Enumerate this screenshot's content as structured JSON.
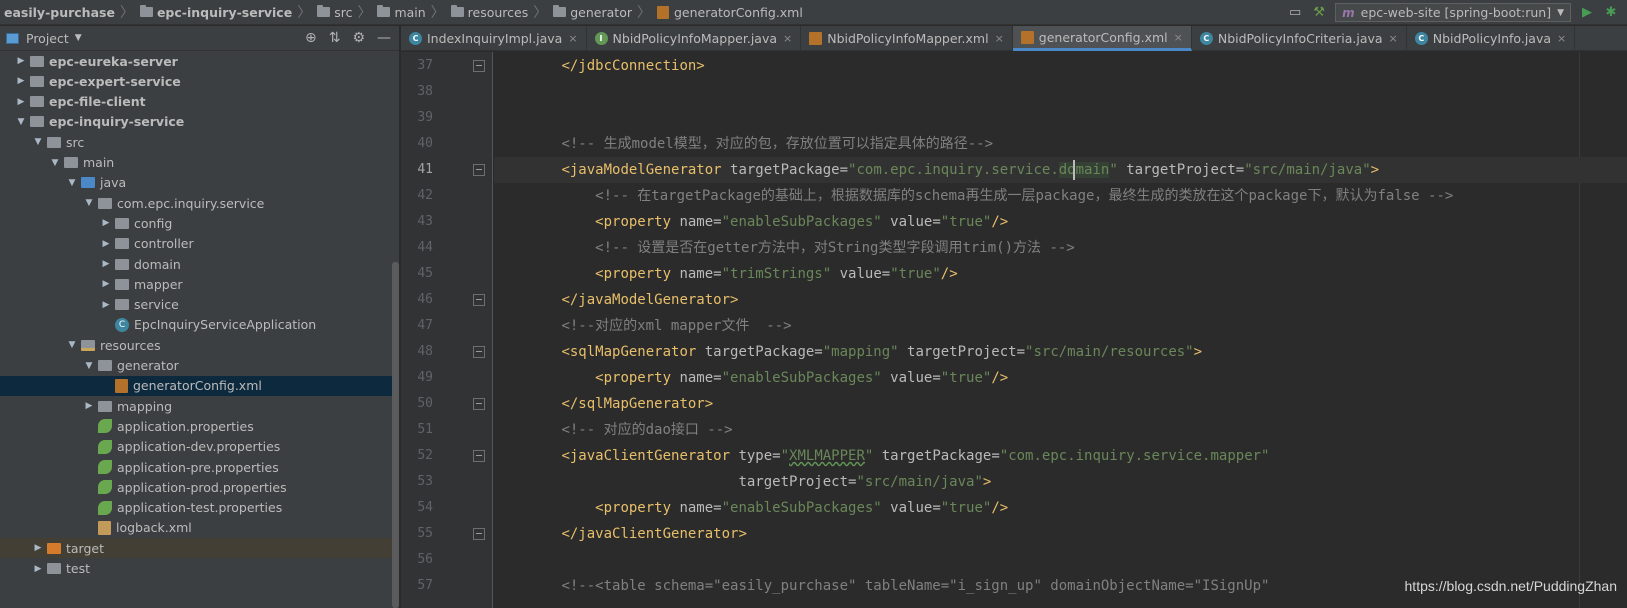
{
  "breadcrumbs": [
    "easily-purchase",
    "epc-inquiry-service",
    "src",
    "main",
    "resources",
    "generator",
    "generatorConfig.xml"
  ],
  "run_config": {
    "label": "epc-web-site [spring-boot:run]"
  },
  "project_panel": {
    "title": "Project"
  },
  "tree": [
    {
      "label": "epc-eureka-server",
      "depth": 1,
      "arrow": "right",
      "icon": "module-folder",
      "bold": true
    },
    {
      "label": "epc-expert-service",
      "depth": 1,
      "arrow": "right",
      "icon": "module-folder",
      "bold": true
    },
    {
      "label": "epc-file-client",
      "depth": 1,
      "arrow": "right",
      "icon": "module-folder",
      "bold": true
    },
    {
      "label": "epc-inquiry-service",
      "depth": 1,
      "arrow": "down",
      "icon": "module-folder",
      "bold": true
    },
    {
      "label": "src",
      "depth": 2,
      "arrow": "down",
      "icon": "folder"
    },
    {
      "label": "main",
      "depth": 3,
      "arrow": "down",
      "icon": "folder"
    },
    {
      "label": "java",
      "depth": 4,
      "arrow": "down",
      "icon": "source-folder"
    },
    {
      "label": "com.epc.inquiry.service",
      "depth": 5,
      "arrow": "down",
      "icon": "package"
    },
    {
      "label": "config",
      "depth": 6,
      "arrow": "right",
      "icon": "package"
    },
    {
      "label": "controller",
      "depth": 6,
      "arrow": "right",
      "icon": "package"
    },
    {
      "label": "domain",
      "depth": 6,
      "arrow": "right",
      "icon": "package"
    },
    {
      "label": "mapper",
      "depth": 6,
      "arrow": "right",
      "icon": "package"
    },
    {
      "label": "service",
      "depth": 6,
      "arrow": "right",
      "icon": "package"
    },
    {
      "label": "EpcInquiryServiceApplication",
      "depth": 6,
      "arrow": "none",
      "icon": "spring-class"
    },
    {
      "label": "resources",
      "depth": 4,
      "arrow": "down",
      "icon": "resources-folder"
    },
    {
      "label": "generator",
      "depth": 5,
      "arrow": "down",
      "icon": "folder"
    },
    {
      "label": "generatorConfig.xml",
      "depth": 6,
      "arrow": "none",
      "icon": "xml-file",
      "selected": true
    },
    {
      "label": "mapping",
      "depth": 5,
      "arrow": "right",
      "icon": "folder"
    },
    {
      "label": "application.properties",
      "depth": 5,
      "arrow": "none",
      "icon": "spring-properties"
    },
    {
      "label": "application-dev.properties",
      "depth": 5,
      "arrow": "none",
      "icon": "spring-properties"
    },
    {
      "label": "application-pre.properties",
      "depth": 5,
      "arrow": "none",
      "icon": "spring-properties"
    },
    {
      "label": "application-prod.properties",
      "depth": 5,
      "arrow": "none",
      "icon": "spring-properties"
    },
    {
      "label": "application-test.properties",
      "depth": 5,
      "arrow": "none",
      "icon": "spring-properties"
    },
    {
      "label": "logback.xml",
      "depth": 5,
      "arrow": "none",
      "icon": "logback-file"
    },
    {
      "label": "target",
      "depth": 2,
      "arrow": "right",
      "icon": "excluded-folder",
      "excluded": true
    },
    {
      "label": "test",
      "depth": 2,
      "arrow": "right",
      "icon": "folder"
    }
  ],
  "tabs": [
    {
      "label": "IndexInquiryImpl.java",
      "icon": "class"
    },
    {
      "label": "NbidPolicyInfoMapper.java",
      "icon": "interface"
    },
    {
      "label": "NbidPolicyInfoMapper.xml",
      "icon": "xml"
    },
    {
      "label": "generatorConfig.xml",
      "icon": "xml",
      "active": true
    },
    {
      "label": "NbidPolicyInfoCriteria.java",
      "icon": "class"
    },
    {
      "label": "NbidPolicyInfo.java",
      "icon": "class"
    }
  ],
  "editor": {
    "current_line": 41,
    "lines": [
      {
        "n": 37,
        "fold": true,
        "tokens": [
          [
            "p",
            "        "
          ],
          [
            "tag",
            "</jdbcConnection>"
          ]
        ]
      },
      {
        "n": 38,
        "tokens": []
      },
      {
        "n": 39,
        "tokens": []
      },
      {
        "n": 40,
        "tokens": [
          [
            "p",
            "        "
          ],
          [
            "cmt",
            "<!-- 生成model模型，对应的包，存放位置可以指定具体的路径-->"
          ]
        ]
      },
      {
        "n": 41,
        "fold": true,
        "tokens": [
          [
            "p",
            "        "
          ],
          [
            "tag",
            "<javaModelGenerator"
          ],
          [
            "attr",
            " targetPackage="
          ],
          [
            "val",
            "\"com.epc.inquiry.service."
          ],
          [
            "valhl",
            "domain"
          ],
          [
            "val",
            "\""
          ],
          [
            "attr",
            " targetProject="
          ],
          [
            "val",
            "\"src/main/java\""
          ],
          [
            "tag",
            ">"
          ]
        ]
      },
      {
        "n": 42,
        "tokens": [
          [
            "p",
            "            "
          ],
          [
            "cmt",
            "<!-- 在targetPackage的基础上，根据数据库的schema再生成一层package，最终生成的类放在这个package下，默认为false -->"
          ]
        ]
      },
      {
        "n": 43,
        "tokens": [
          [
            "p",
            "            "
          ],
          [
            "tag",
            "<property"
          ],
          [
            "attr",
            " name="
          ],
          [
            "val",
            "\"enableSubPackages\""
          ],
          [
            "attr",
            " value="
          ],
          [
            "val",
            "\"true\""
          ],
          [
            "tag",
            "/>"
          ]
        ]
      },
      {
        "n": 44,
        "tokens": [
          [
            "p",
            "            "
          ],
          [
            "cmt",
            "<!-- 设置是否在getter方法中，对String类型字段调用trim()方法 -->"
          ]
        ]
      },
      {
        "n": 45,
        "tokens": [
          [
            "p",
            "            "
          ],
          [
            "tag",
            "<property"
          ],
          [
            "attr",
            " name="
          ],
          [
            "val",
            "\"trimStrings\""
          ],
          [
            "attr",
            " value="
          ],
          [
            "val",
            "\"true\""
          ],
          [
            "tag",
            "/>"
          ]
        ]
      },
      {
        "n": 46,
        "fold": true,
        "tokens": [
          [
            "p",
            "        "
          ],
          [
            "tag",
            "</javaModelGenerator>"
          ]
        ]
      },
      {
        "n": 47,
        "tokens": [
          [
            "p",
            "        "
          ],
          [
            "cmt",
            "<!--对应的xml mapper文件  -->"
          ]
        ]
      },
      {
        "n": 48,
        "fold": true,
        "tokens": [
          [
            "p",
            "        "
          ],
          [
            "tag",
            "<sqlMapGenerator"
          ],
          [
            "attr",
            " targetPackage="
          ],
          [
            "val",
            "\"mapping\""
          ],
          [
            "attr",
            " targetProject="
          ],
          [
            "val",
            "\"src/main/resources\""
          ],
          [
            "tag",
            ">"
          ]
        ]
      },
      {
        "n": 49,
        "tokens": [
          [
            "p",
            "            "
          ],
          [
            "tag",
            "<property"
          ],
          [
            "attr",
            " name="
          ],
          [
            "val",
            "\"enableSubPackages\""
          ],
          [
            "attr",
            " value="
          ],
          [
            "val",
            "\"true\""
          ],
          [
            "tag",
            "/>"
          ]
        ]
      },
      {
        "n": 50,
        "fold": true,
        "tokens": [
          [
            "p",
            "        "
          ],
          [
            "tag",
            "</sqlMapGenerator>"
          ]
        ]
      },
      {
        "n": 51,
        "tokens": [
          [
            "p",
            "        "
          ],
          [
            "cmt",
            "<!-- 对应的dao接口 -->"
          ]
        ]
      },
      {
        "n": 52,
        "fold": true,
        "tokens": [
          [
            "p",
            "        "
          ],
          [
            "tag",
            "<javaClientGenerator"
          ],
          [
            "attr",
            " type="
          ],
          [
            "val",
            "\""
          ],
          [
            "valtypo",
            "XMLMAPPER"
          ],
          [
            "val",
            "\""
          ],
          [
            "attr",
            " targetPackage="
          ],
          [
            "val",
            "\"com.epc.inquiry.service.mapper\""
          ]
        ]
      },
      {
        "n": 53,
        "tokens": [
          [
            "p",
            "                             "
          ],
          [
            "attr",
            "targetProject="
          ],
          [
            "val",
            "\"src/main/java\""
          ],
          [
            "tag",
            ">"
          ]
        ]
      },
      {
        "n": 54,
        "tokens": [
          [
            "p",
            "            "
          ],
          [
            "tag",
            "<property"
          ],
          [
            "attr",
            " name="
          ],
          [
            "val",
            "\"enableSubPackages\""
          ],
          [
            "attr",
            " value="
          ],
          [
            "val",
            "\"true\""
          ],
          [
            "tag",
            "/>"
          ]
        ]
      },
      {
        "n": 55,
        "fold": true,
        "tokens": [
          [
            "p",
            "        "
          ],
          [
            "tag",
            "</javaClientGenerator>"
          ]
        ]
      },
      {
        "n": 56,
        "tokens": []
      },
      {
        "n": 57,
        "tokens": [
          [
            "p",
            "        "
          ],
          [
            "cmt",
            "<!--<table schema=\"easily_purchase\" tableName=\"i_sign_up\" domainObjectName=\"ISignUp\""
          ]
        ]
      }
    ]
  },
  "watermark": "https://blog.csdn.net/PuddingZhan"
}
